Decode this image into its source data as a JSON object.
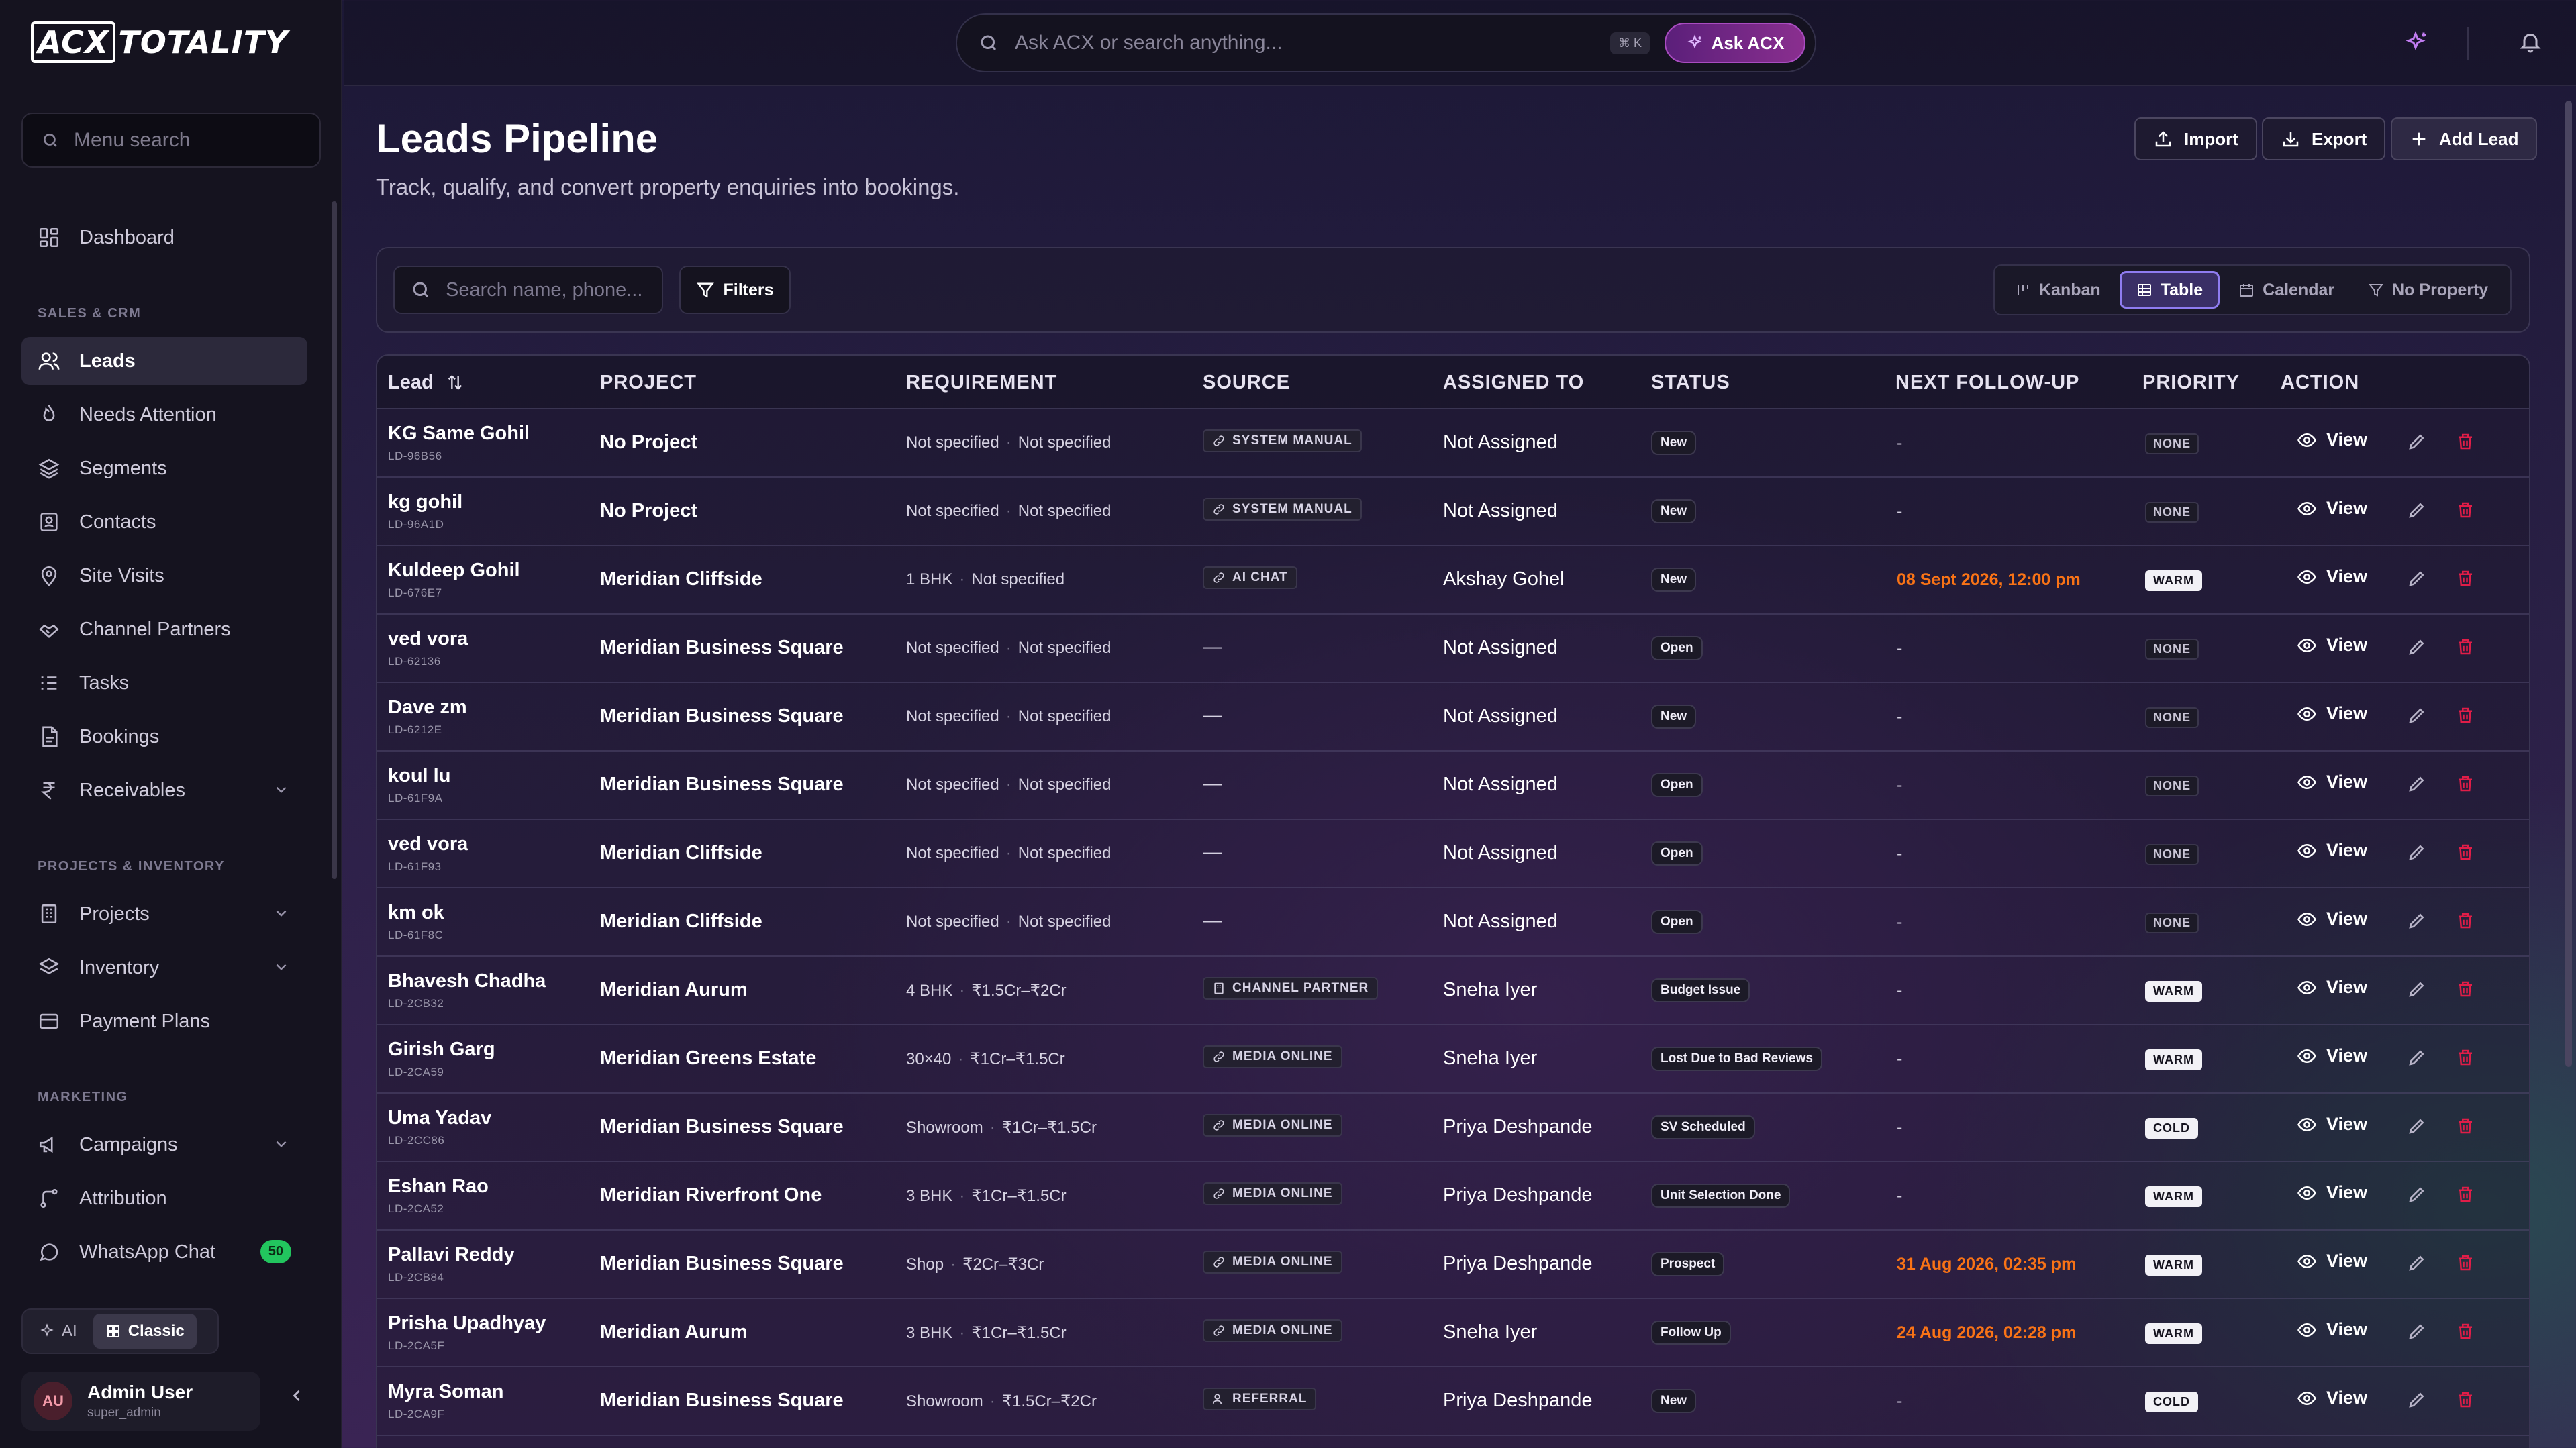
{
  "brand": {
    "logo_left": "ACX",
    "logo_right": "TOTALITY"
  },
  "sidebar": {
    "search_placeholder": "Menu search",
    "sections": {
      "sales": "SALES & CRM",
      "projects": "PROJECTS & INVENTORY",
      "marketing": "MARKETING"
    },
    "items": [
      {
        "label": "Dashboard"
      },
      {
        "label": "Leads"
      },
      {
        "label": "Needs Attention"
      },
      {
        "label": "Segments"
      },
      {
        "label": "Contacts"
      },
      {
        "label": "Site Visits"
      },
      {
        "label": "Channel Partners"
      },
      {
        "label": "Tasks"
      },
      {
        "label": "Bookings"
      },
      {
        "label": "Receivables"
      },
      {
        "label": "Projects"
      },
      {
        "label": "Inventory"
      },
      {
        "label": "Payment Plans"
      },
      {
        "label": "Campaigns"
      },
      {
        "label": "Attribution"
      },
      {
        "label": "WhatsApp Chat",
        "badge": "50"
      }
    ],
    "mode": {
      "ai": "AI",
      "classic": "Classic"
    },
    "user": {
      "initials": "AU",
      "name": "Admin User",
      "role": "super_admin"
    }
  },
  "topbar": {
    "search_placeholder": "Ask ACX or search anything...",
    "shortcut": "⌘ K",
    "ask_label": "Ask ACX"
  },
  "header": {
    "title": "Leads Pipeline",
    "subtitle": "Track, qualify, and convert property enquiries into bookings.",
    "import_label": "Import",
    "export_label": "Export",
    "add_label": "Add Lead"
  },
  "toolbar": {
    "search_placeholder": "Search name, phone...",
    "filters_label": "Filters",
    "views": [
      "Kanban",
      "Table",
      "Calendar",
      "No Property"
    ],
    "active_view": "Table"
  },
  "table": {
    "columns": [
      "Lead",
      "PROJECT",
      "REQUIREMENT",
      "SOURCE",
      "ASSIGNED TO",
      "STATUS",
      "NEXT FOLLOW-UP",
      "PRIORITY",
      "ACTION"
    ],
    "view_label": "View",
    "rows": [
      {
        "name": "KG Same Gohil",
        "id": "LD-96B56",
        "project": "No Project",
        "req1": "Not specified",
        "req2": "Not specified",
        "source": "SYSTEM MANUAL",
        "source_icon": "link-icon",
        "assigned": "Not Assigned",
        "status": "New",
        "followup": "-",
        "followup_hl": false,
        "priority": "NONE"
      },
      {
        "name": "kg gohil",
        "id": "LD-96A1D",
        "project": "No Project",
        "req1": "Not specified",
        "req2": "Not specified",
        "source": "SYSTEM MANUAL",
        "source_icon": "link-icon",
        "assigned": "Not Assigned",
        "status": "New",
        "followup": "-",
        "followup_hl": false,
        "priority": "NONE"
      },
      {
        "name": "Kuldeep Gohil",
        "id": "LD-676E7",
        "project": "Meridian Cliffside",
        "req1": "1 BHK",
        "req2": "Not specified",
        "source": "AI CHAT",
        "source_icon": "link-icon",
        "assigned": "Akshay Gohel",
        "status": "New",
        "followup": "08 Sept 2026, 12:00 pm",
        "followup_hl": true,
        "priority": "WARM"
      },
      {
        "name": "ved vora",
        "id": "LD-62136",
        "project": "Meridian Business Square",
        "req1": "Not specified",
        "req2": "Not specified",
        "source": "—",
        "source_icon": "",
        "assigned": "Not Assigned",
        "status": "Open",
        "followup": "-",
        "followup_hl": false,
        "priority": "NONE"
      },
      {
        "name": "Dave zm",
        "id": "LD-6212E",
        "project": "Meridian Business Square",
        "req1": "Not specified",
        "req2": "Not specified",
        "source": "—",
        "source_icon": "",
        "assigned": "Not Assigned",
        "status": "New",
        "followup": "-",
        "followup_hl": false,
        "priority": "NONE"
      },
      {
        "name": "koul lu",
        "id": "LD-61F9A",
        "project": "Meridian Business Square",
        "req1": "Not specified",
        "req2": "Not specified",
        "source": "—",
        "source_icon": "",
        "assigned": "Not Assigned",
        "status": "Open",
        "followup": "-",
        "followup_hl": false,
        "priority": "NONE"
      },
      {
        "name": "ved vora",
        "id": "LD-61F93",
        "project": "Meridian Cliffside",
        "req1": "Not specified",
        "req2": "Not specified",
        "source": "—",
        "source_icon": "",
        "assigned": "Not Assigned",
        "status": "Open",
        "followup": "-",
        "followup_hl": false,
        "priority": "NONE"
      },
      {
        "name": "km ok",
        "id": "LD-61F8C",
        "project": "Meridian Cliffside",
        "req1": "Not specified",
        "req2": "Not specified",
        "source": "—",
        "source_icon": "",
        "assigned": "Not Assigned",
        "status": "Open",
        "followup": "-",
        "followup_hl": false,
        "priority": "NONE"
      },
      {
        "name": "Bhavesh Chadha",
        "id": "LD-2CB32",
        "project": "Meridian Aurum",
        "req1": "4 BHK",
        "req2": "₹1.5Cr–₹2Cr",
        "source": "CHANNEL PARTNER",
        "source_icon": "building-icon",
        "assigned": "Sneha Iyer",
        "status": "Budget Issue",
        "followup": "-",
        "followup_hl": false,
        "priority": "WARM"
      },
      {
        "name": "Girish Garg",
        "id": "LD-2CA59",
        "project": "Meridian Greens Estate",
        "req1": "30×40",
        "req2": "₹1Cr–₹1.5Cr",
        "source": "MEDIA ONLINE",
        "source_icon": "link-icon",
        "assigned": "Sneha Iyer",
        "status": "Lost Due to Bad Reviews",
        "followup": "-",
        "followup_hl": false,
        "priority": "WARM"
      },
      {
        "name": "Uma Yadav",
        "id": "LD-2CC86",
        "project": "Meridian Business Square",
        "req1": "Showroom",
        "req2": "₹1Cr–₹1.5Cr",
        "source": "MEDIA ONLINE",
        "source_icon": "link-icon",
        "assigned": "Priya Deshpande",
        "status": "SV Scheduled",
        "followup": "-",
        "followup_hl": false,
        "priority": "COLD"
      },
      {
        "name": "Eshan Rao",
        "id": "LD-2CA52",
        "project": "Meridian Riverfront One",
        "req1": "3 BHK",
        "req2": "₹1Cr–₹1.5Cr",
        "source": "MEDIA ONLINE",
        "source_icon": "link-icon",
        "assigned": "Priya Deshpande",
        "status": "Unit Selection Done",
        "followup": "-",
        "followup_hl": false,
        "priority": "WARM"
      },
      {
        "name": "Pallavi Reddy",
        "id": "LD-2CB84",
        "project": "Meridian Business Square",
        "req1": "Shop",
        "req2": "₹2Cr–₹3Cr",
        "source": "MEDIA ONLINE",
        "source_icon": "link-icon",
        "assigned": "Priya Deshpande",
        "status": "Prospect",
        "followup": "31 Aug 2026, 02:35 pm",
        "followup_hl": true,
        "priority": "WARM"
      },
      {
        "name": "Prisha Upadhyay",
        "id": "LD-2CA5F",
        "project": "Meridian Aurum",
        "req1": "3 BHK",
        "req2": "₹1Cr–₹1.5Cr",
        "source": "MEDIA ONLINE",
        "source_icon": "link-icon",
        "assigned": "Sneha Iyer",
        "status": "Follow Up",
        "followup": "24 Aug 2026, 02:28 pm",
        "followup_hl": true,
        "priority": "WARM"
      },
      {
        "name": "Myra Soman",
        "id": "LD-2CA9F",
        "project": "Meridian Business Square",
        "req1": "Showroom",
        "req2": "₹1.5Cr–₹2Cr",
        "source": "REFERRAL",
        "source_icon": "people-icon",
        "assigned": "Priya Deshpande",
        "status": "New",
        "followup": "-",
        "followup_hl": false,
        "priority": "COLD"
      }
    ]
  },
  "colors": {
    "accent": "#8f7cf0",
    "followup_highlight": "#f97316",
    "delete": "#e11d48",
    "badge_green": "#22c55e"
  }
}
